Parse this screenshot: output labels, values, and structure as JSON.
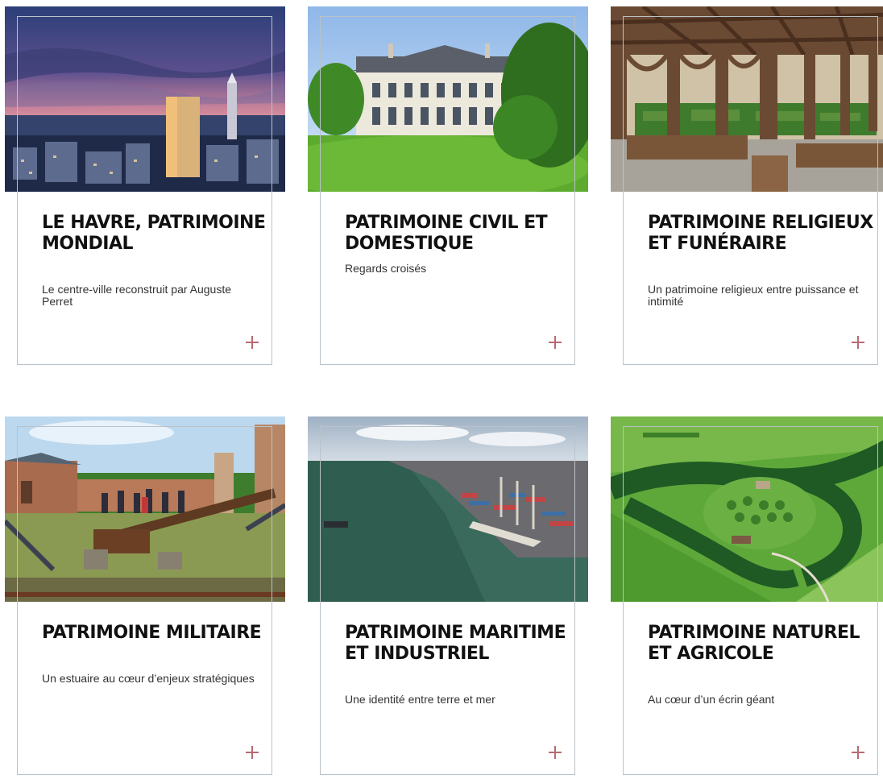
{
  "cards": [
    {
      "title": "Le Havre, patrimoine mondial",
      "subtitle": "Le centre-ville reconstruit par Auguste Perret",
      "image": "city-skyline-dusk-image",
      "plus_icon": "plus-icon"
    },
    {
      "title": "Patrimoine civil et domestique",
      "subtitle": "Regards croisés",
      "image": "chateau-lawn-image",
      "plus_icon": "plus-icon"
    },
    {
      "title": "Patrimoine religieux et funéraire",
      "subtitle": "Un patrimoine religieux entre puissance et intimité",
      "image": "cloister-garden-image",
      "plus_icon": "plus-icon"
    },
    {
      "title": "Patrimoine militaire",
      "subtitle": "Un estuaire au cœur d’enjeux stratégiques",
      "image": "fort-cannon-image",
      "plus_icon": "plus-icon"
    },
    {
      "title": "Patrimoine maritime et industriel",
      "subtitle": "Une identité entre terre et mer",
      "image": "port-estuary-image",
      "plus_icon": "plus-icon"
    },
    {
      "title": "Patrimoine naturel et agricole",
      "subtitle": "Au cœur d’un écrin géant",
      "image": "aerial-farmland-image",
      "plus_icon": "plus-icon"
    }
  ],
  "colors": {
    "accent": "#b86a72",
    "card_border": "#b9c2c8",
    "title": "#111111",
    "subtitle": "#333333"
  }
}
